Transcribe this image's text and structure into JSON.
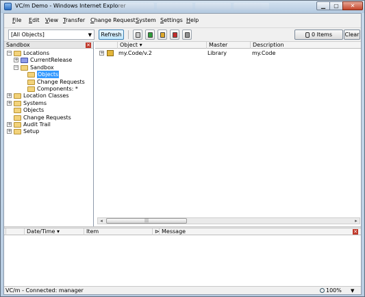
{
  "window": {
    "title": "VC/m Demo - Windows Internet Explorer"
  },
  "menu": [
    "File",
    "Edit",
    "View",
    "Transfer",
    "Change Request",
    "System",
    "Settings",
    "Help"
  ],
  "toolbar": {
    "scope_value": "[All Objects]",
    "refresh_label": "Refresh",
    "items_label": "0 Items",
    "clear_label": "Clear",
    "object_icons": [
      {
        "name": "object-wire-icon",
        "color": "#c9c9c9"
      },
      {
        "name": "object-green-icon",
        "color": "#2e9e3a"
      },
      {
        "name": "object-gold-icon",
        "color": "#e0a92a"
      },
      {
        "name": "object-red-icon",
        "color": "#c42d2d"
      },
      {
        "name": "object-gray-icon",
        "color": "#8f8f8f"
      }
    ]
  },
  "left_pane": {
    "title": "Sandbox",
    "tree": [
      {
        "label": "Locations",
        "expander": "−"
      },
      {
        "label": "CurrentRelease",
        "expander": "+"
      },
      {
        "label": "Sandbox",
        "expander": "−"
      },
      {
        "label": "Objects",
        "expander": ""
      },
      {
        "label": "Change Requests",
        "expander": ""
      },
      {
        "label": "Components: *",
        "expander": ""
      },
      {
        "label": "Location Classes",
        "expander": "+"
      },
      {
        "label": "Systems",
        "expander": "+"
      },
      {
        "label": "Objects",
        "expander": ""
      },
      {
        "label": "Change Requests",
        "expander": ""
      },
      {
        "label": "Audit Trail",
        "expander": "+"
      },
      {
        "label": "Setup",
        "expander": "+"
      }
    ]
  },
  "grid": {
    "columns": [
      "Object",
      "Master",
      "Description"
    ],
    "rows": [
      {
        "expander": "+",
        "object": "my.Code/v.2",
        "master": "Library",
        "description": "my.Code"
      }
    ]
  },
  "messages": {
    "columns": [
      "Date/Time",
      "Item",
      "Message"
    ]
  },
  "status": {
    "text": "VC/m - Connected: manager",
    "zoom": "100%"
  }
}
